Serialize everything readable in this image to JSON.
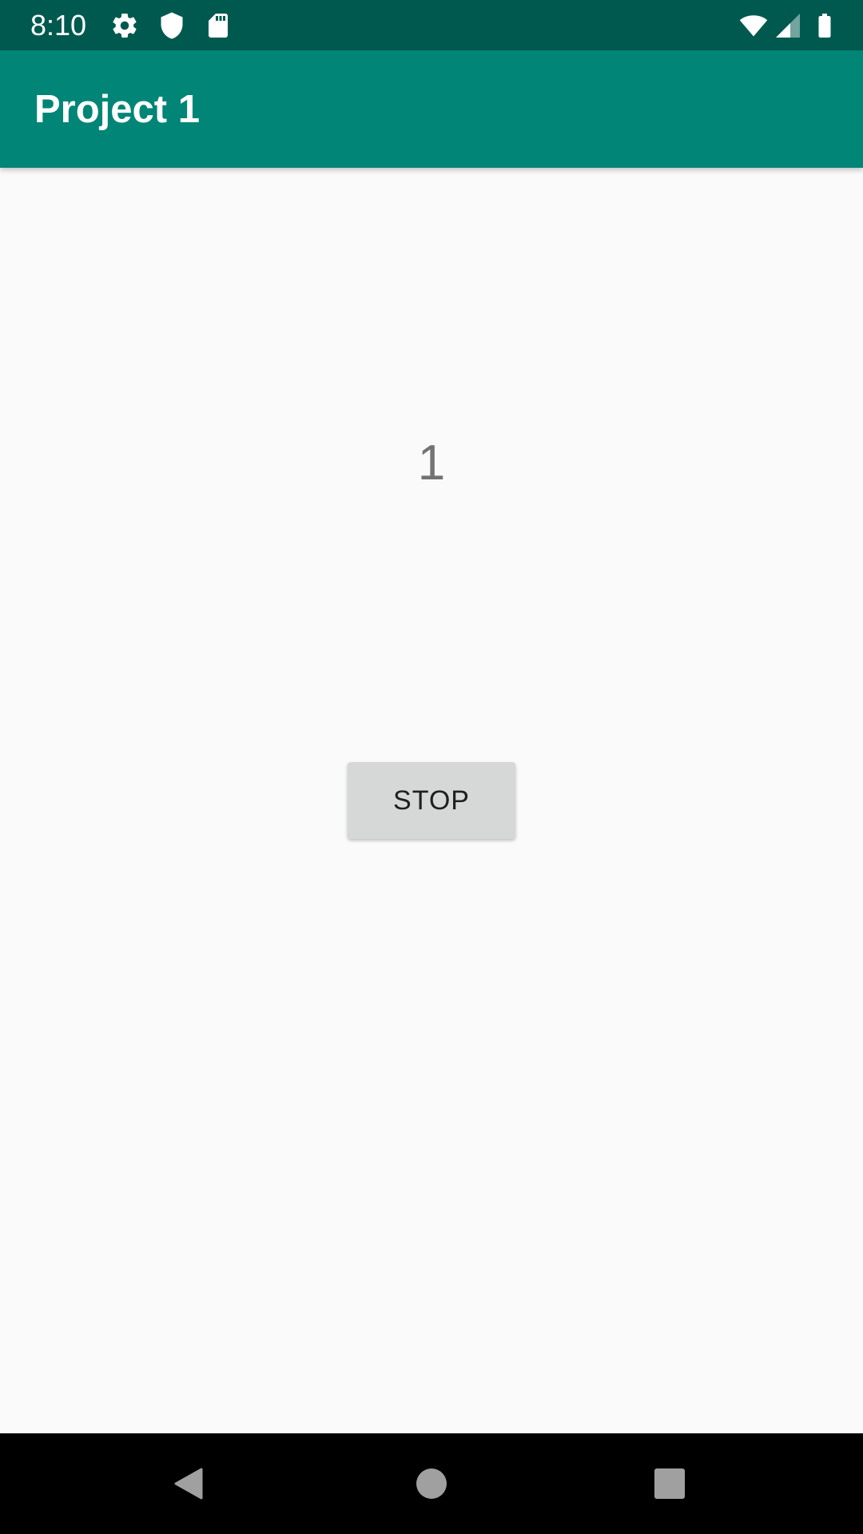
{
  "status_bar": {
    "time": "8:10",
    "left_icons": [
      "gear-icon",
      "shield-icon",
      "sd-card-icon"
    ],
    "right_icons": [
      "wifi-icon",
      "signal-icon",
      "battery-icon"
    ],
    "background_color": "#00594f"
  },
  "app_bar": {
    "title": "Project 1",
    "background_color": "#008577"
  },
  "main": {
    "counter_value": "1",
    "stop_button_label": "STOP"
  },
  "nav_bar": {
    "buttons": [
      "back-icon",
      "home-icon",
      "recents-icon"
    ]
  }
}
